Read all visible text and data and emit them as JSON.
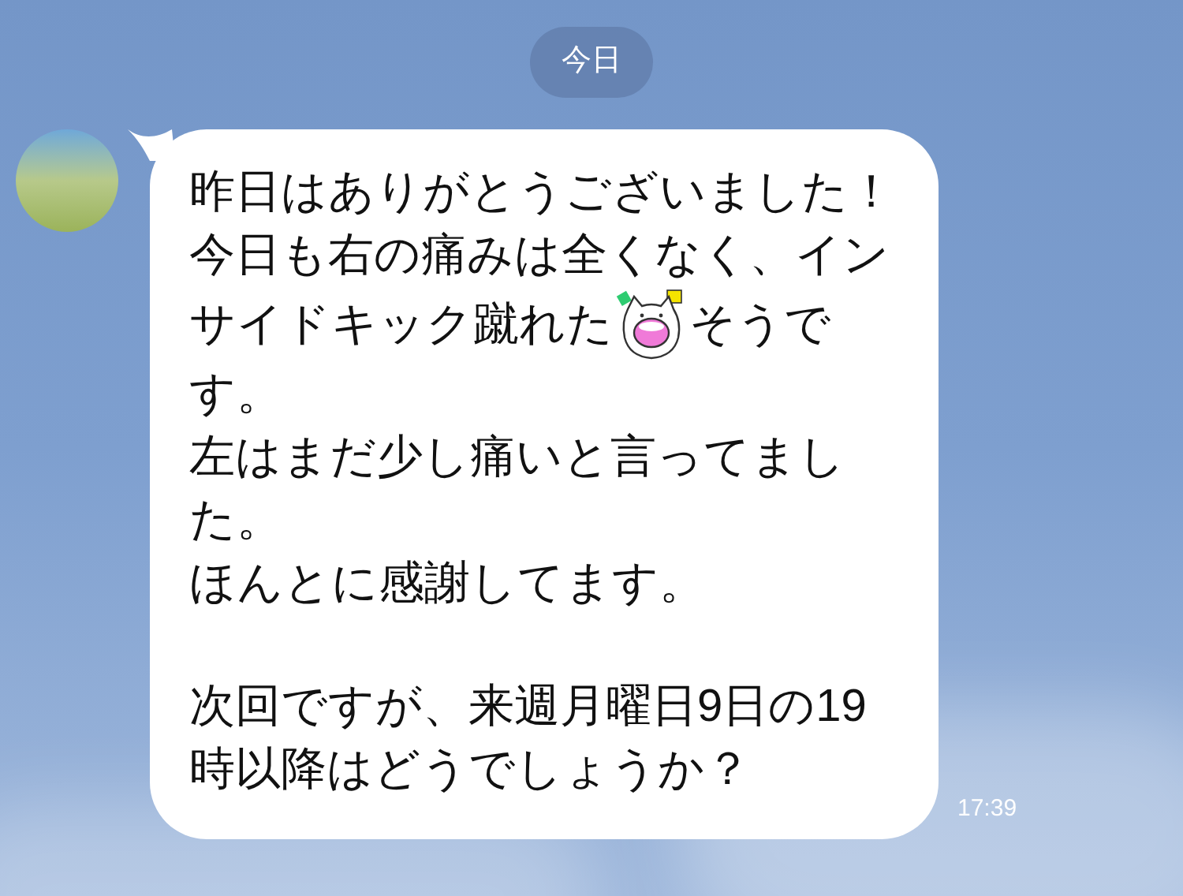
{
  "date_pill": "今日",
  "message": {
    "paragraphs": [
      [
        [
          {
            "kind": "text",
            "text": "昨日はありがとうございました！"
          }
        ],
        [
          {
            "kind": "text",
            "text": "今日も右の痛みは全くなく、イン"
          }
        ],
        [
          {
            "kind": "text",
            "text": "サイドキック蹴れた"
          },
          {
            "kind": "emoji"
          },
          {
            "kind": "text",
            "text": "そうで"
          }
        ],
        [
          {
            "kind": "text",
            "text": "す。"
          }
        ],
        [
          {
            "kind": "text",
            "text": "左はまだ少し痛いと言ってまし"
          }
        ],
        [
          {
            "kind": "text",
            "text": "た。"
          }
        ],
        [
          {
            "kind": "text",
            "text": "ほんとに感謝してます。"
          }
        ]
      ],
      [
        [
          {
            "kind": "text",
            "text": "次回ですが、来週月曜日9日の19"
          }
        ],
        [
          {
            "kind": "text",
            "text": "時以降はどうでしょうか？"
          }
        ]
      ]
    ],
    "time": "17:39"
  }
}
